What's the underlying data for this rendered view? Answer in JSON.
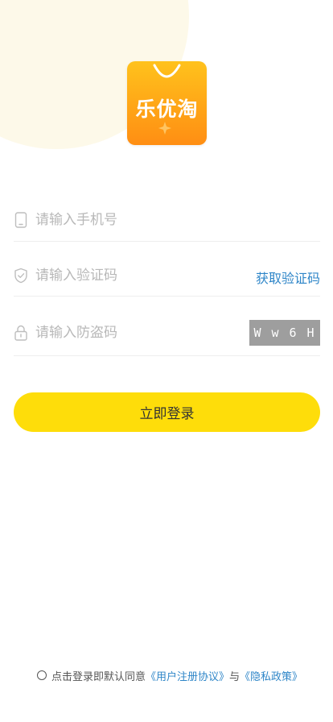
{
  "logo": {
    "text": "乐优淘"
  },
  "fields": {
    "phone": {
      "placeholder": "请输入手机号",
      "icon": "phone-icon"
    },
    "code": {
      "placeholder": "请输入验证码",
      "icon": "shield-icon",
      "action_label": "获取验证码"
    },
    "captcha": {
      "placeholder": "请输入防盗码",
      "icon": "lock-icon",
      "image_text": [
        "W",
        "w",
        "6",
        "H"
      ]
    }
  },
  "login_button": {
    "label": "立即登录"
  },
  "agreement": {
    "prefix": "点击登录即默认同意",
    "terms_link": "《用户注册协议》",
    "and": "与",
    "privacy_link": "《隐私政策》"
  },
  "colors": {
    "accent": "#fedd0a",
    "link": "#2f86c8",
    "logo_top": "#ffc21c",
    "logo_bottom": "#ff8e13"
  }
}
